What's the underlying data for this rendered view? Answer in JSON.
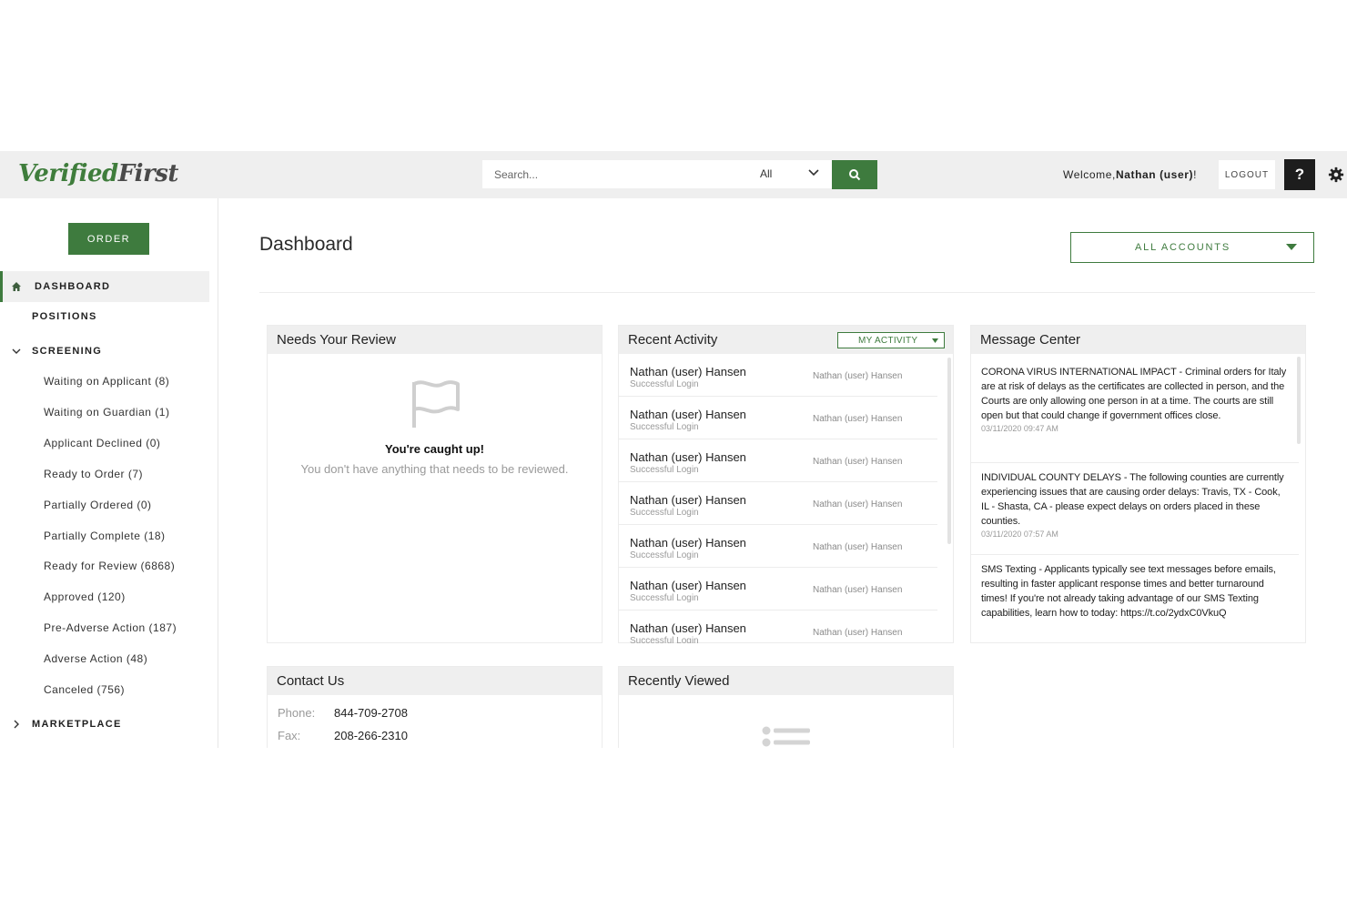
{
  "brand": {
    "name_part1": "Verified",
    "name_part2": "First"
  },
  "header": {
    "search_placeholder": "Search...",
    "search_scope": "All",
    "welcome_prefix": "Welcome,",
    "welcome_user": "Nathan (user)",
    "welcome_suffix": "!",
    "logout_label": "LOGOUT",
    "help_label": "?"
  },
  "sidebar": {
    "order_label": "ORDER",
    "dashboard_label": "DASHBOARD",
    "positions_label": "POSITIONS",
    "screening_label": "SCREENING",
    "marketplace_label": "MARKETPLACE",
    "screening_items": [
      "Waiting on Applicant (8)",
      "Waiting on Guardian (1)",
      "Applicant Declined (0)",
      "Ready to Order (7)",
      "Partially Ordered (0)",
      "Partially Complete (18)",
      "Ready for Review (6868)",
      "Approved (120)",
      "Pre-Adverse Action (187)",
      "Adverse Action (48)",
      "Canceled (756)"
    ]
  },
  "main": {
    "title": "Dashboard",
    "accounts_select": "ALL ACCOUNTS"
  },
  "review": {
    "title": "Needs Your Review",
    "empty_title": "You're caught up!",
    "empty_text": "You don't have anything that needs to be reviewed."
  },
  "activity": {
    "title": "Recent Activity",
    "filter_label": "MY ACTIVITY",
    "rows": [
      {
        "name": "Nathan (user) Hansen",
        "event": "Successful Login",
        "user": "Nathan (user) Hansen"
      },
      {
        "name": "Nathan (user) Hansen",
        "event": "Successful Login",
        "user": "Nathan (user) Hansen"
      },
      {
        "name": "Nathan (user) Hansen",
        "event": "Successful Login",
        "user": "Nathan (user) Hansen"
      },
      {
        "name": "Nathan (user) Hansen",
        "event": "Successful Login",
        "user": "Nathan (user) Hansen"
      },
      {
        "name": "Nathan (user) Hansen",
        "event": "Successful Login",
        "user": "Nathan (user) Hansen"
      },
      {
        "name": "Nathan (user) Hansen",
        "event": "Successful Login",
        "user": "Nathan (user) Hansen"
      },
      {
        "name": "Nathan (user) Hansen",
        "event": "Successful Login",
        "user": "Nathan (user) Hansen"
      }
    ]
  },
  "messages": {
    "title": "Message Center",
    "items": [
      {
        "text": "CORONA VIRUS INTERNATIONAL IMPACT - Criminal orders for Italy are at risk of delays as the certificates are collected in person, and the Courts are only allowing one person in at a time. The courts are still open but that could change if government offices close.",
        "date": "03/11/2020 09:47 AM"
      },
      {
        "text": "INDIVIDUAL COUNTY DELAYS - The following counties are currently experiencing issues that are causing order delays: Travis, TX - Cook, IL - Shasta, CA - please expect delays on orders placed in these counties.",
        "date": "03/11/2020 07:57 AM"
      },
      {
        "text": "SMS Texting - Applicants typically see text messages before emails, resulting in faster applicant response times and better turnaround times! If you're not already taking advantage of our SMS Texting capabilities, learn how to today: https://t.co/2ydxC0VkuQ",
        "date": ""
      }
    ]
  },
  "contact": {
    "title": "Contact Us",
    "phone_label": "Phone:",
    "phone_value": "844-709-2708",
    "fax_label": "Fax:",
    "fax_value": "208-266-2310"
  },
  "recent": {
    "title": "Recently Viewed"
  },
  "colors": {
    "brand_green": "#3e7b3e",
    "panel_header": "#efefef",
    "topbar": "#efefef"
  },
  "icons": [
    "search-icon",
    "chevron-down-icon",
    "gear-icon",
    "home-icon",
    "chevron-right-icon",
    "flag-icon",
    "list-icon",
    "caret-down-icon"
  ]
}
